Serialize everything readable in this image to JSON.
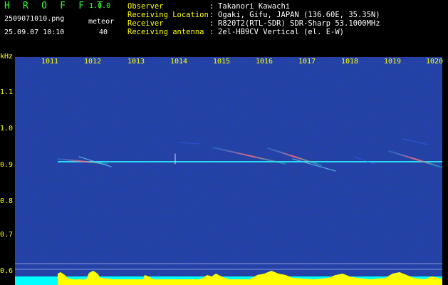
{
  "header": {
    "app_name": "H R O F F T",
    "app_version": "1.0.0",
    "file_name": "2509071010.png",
    "meteor_label": "meteor",
    "date_time": "25.09.07 10:10",
    "meteor_count": "40",
    "info": [
      {
        "label": "Observer",
        "value": "Takanori Kawachi"
      },
      {
        "label": "Receiving Location",
        "value": "Ogaki, Gifu, JAPAN (136.60E, 35.35N)"
      },
      {
        "label": "Receiver",
        "value": "R820T2(RTL-SDR) SDR-Sharp 53.1000MHz"
      },
      {
        "label": "Receiving antenna",
        "value": "2el-HB9CV Vertical (el. E-W)"
      }
    ],
    "colon": ":"
  },
  "axes": {
    "y_unit": "kHz",
    "time_ticks": [
      "1011",
      "1012",
      "1013",
      "1014",
      "1015",
      "1016",
      "1017",
      "1018",
      "1019",
      "1020"
    ],
    "freq_ticks": [
      "1.1",
      "1.0",
      "0.9",
      "0.8",
      "0.7",
      "0.6"
    ]
  },
  "colors": {
    "background": "#000000",
    "title_green": "#33ff33",
    "label_yellow": "#ffff00",
    "text_white": "#ffffff",
    "plot_bg": "#050f5a",
    "signal_cyan": "#00ffff",
    "audio_yellow": "#ffff00"
  }
}
